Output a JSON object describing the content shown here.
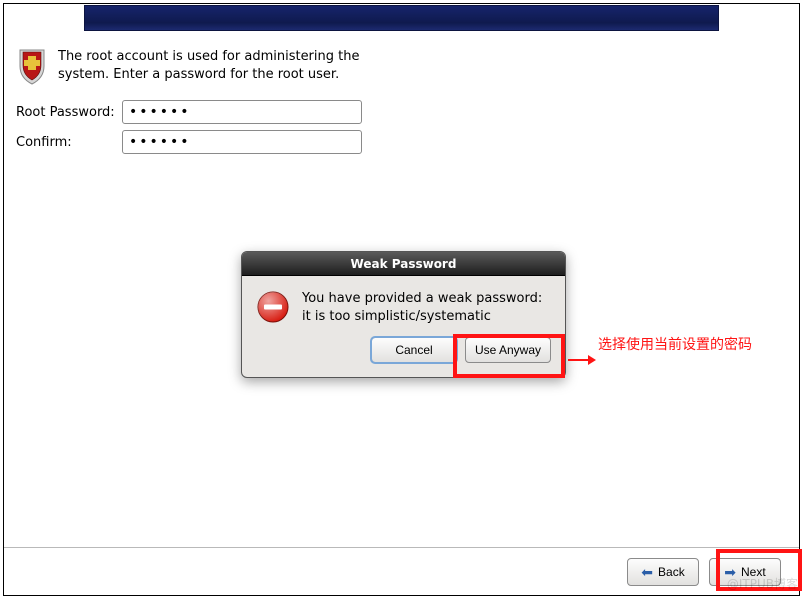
{
  "intro_text": "The root account is used for administering the system.  Enter a password for the root user.",
  "form": {
    "root_label": "Root Password:",
    "confirm_label": "Confirm:",
    "root_value": "••••••",
    "confirm_value": "••••••"
  },
  "dialog": {
    "title": "Weak Password",
    "message": "You have provided a weak password: it is too simplistic/systematic",
    "cancel_label": "Cancel",
    "use_anyway_label": "Use Anyway"
  },
  "annotation": {
    "text": "选择使用当前设置的密码"
  },
  "footer": {
    "back_label": "Back",
    "next_label": "Next"
  },
  "watermark": "@ITPUB博客"
}
